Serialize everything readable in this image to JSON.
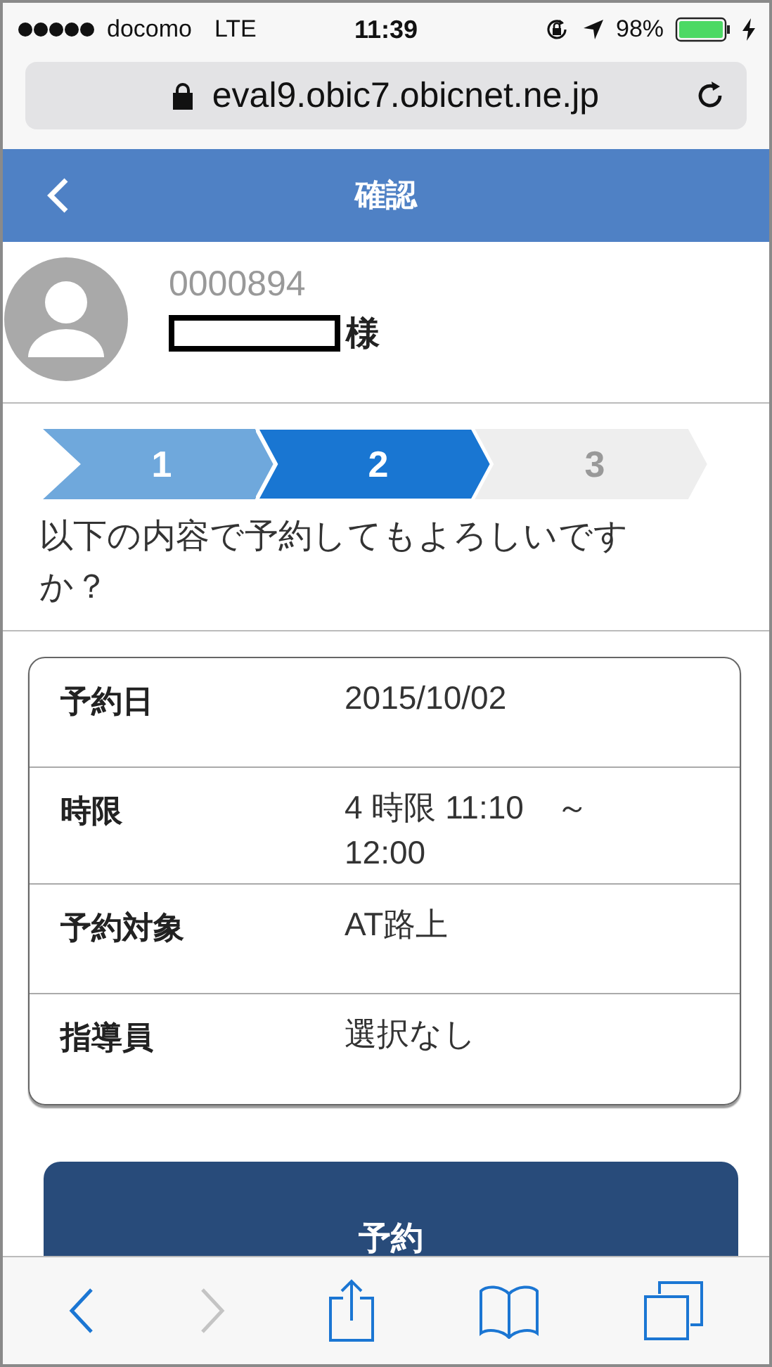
{
  "status_bar": {
    "carrier": "docomo",
    "network": "LTE",
    "time": "11:39",
    "battery": "98%"
  },
  "url_bar": {
    "url": "eval9.obic7.obicnet.ne.jp"
  },
  "header": {
    "title": "確認"
  },
  "profile": {
    "member_number": "0000894",
    "honorific": "様"
  },
  "steps": [
    {
      "label": "1",
      "kind": "done",
      "selected": false
    },
    {
      "label": "2",
      "kind": "current",
      "selected": true
    },
    {
      "label": "3",
      "kind": "todo",
      "selected": false
    }
  ],
  "question": "以下の内容で予約してもよろしいですか？",
  "details": [
    {
      "label": "予約日",
      "value": "2015/10/02"
    },
    {
      "label": "時限",
      "value": "4 時限 11:10　～ 12:00"
    },
    {
      "label": "予約対象",
      "value": "AT路上"
    },
    {
      "label": "指導員",
      "value": "選択なし"
    }
  ],
  "reserve_button": {
    "label": "予約"
  },
  "toolbar": {
    "back_disabled": false,
    "forward_disabled": true
  }
}
